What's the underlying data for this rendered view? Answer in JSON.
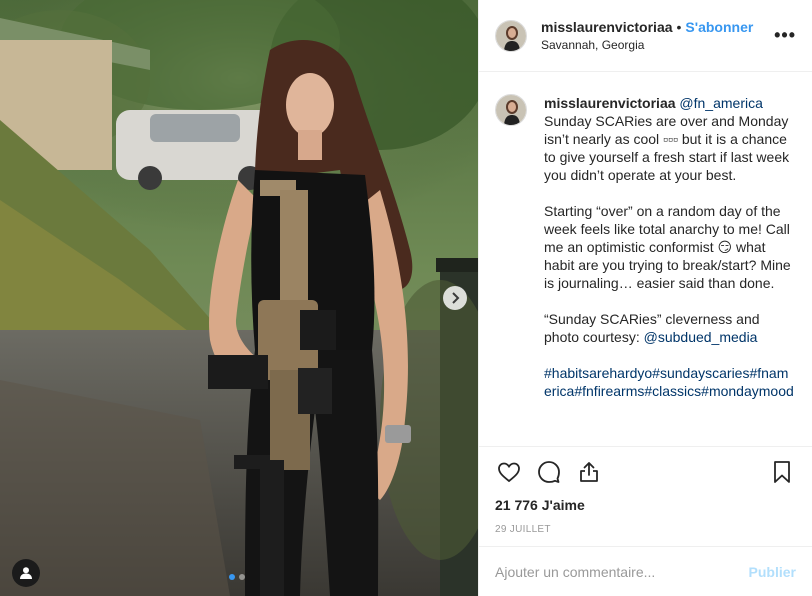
{
  "post": {
    "author": {
      "username": "misslaurenvictoriaa",
      "separator": "•",
      "follow_label": "S'abonner",
      "location": "Savannah, Georgia",
      "avatar_icon": "profile-avatar"
    },
    "photo": {
      "alt": "Woman holding a tan rifle outdoors",
      "carousel_total": 2,
      "carousel_active": 1,
      "next_icon": "chevron-right-icon",
      "tag_icon": "person-icon"
    },
    "caption": {
      "username": "misslaurenvictoriaa",
      "mention": "@fn_america",
      "para1": "Sunday SCARies are over and Monday isn’t nearly as cool ▫▫▫ but it is a chance to give yourself a fresh start if last week you didn’t operate at your best.",
      "para2a": "Starting “over” on a random day of the week feels like total anarchy to me! Call me an optimistic conformist ",
      "emoji": "😏",
      "para2b": " what habit are you trying to break/start? Mine is journaling… easier said than done.",
      "para3": "“Sunday SCARies” cleverness and photo courtesy: ",
      "photo_credit": "@subdued_media",
      "hashtags": "#habitsarehardyo#sundayscaries#fnamerica#fnfirearms#classics#mondaymood"
    },
    "actions": {
      "like_icon": "heart-icon",
      "comment_icon": "comment-icon",
      "share_icon": "share-icon",
      "save_icon": "bookmark-icon"
    },
    "likes_text": "21 776 J'aime",
    "date": "29 JUILLET",
    "comment": {
      "placeholder": "Ajouter un commentaire...",
      "value": "",
      "publish_label": "Publier"
    }
  }
}
